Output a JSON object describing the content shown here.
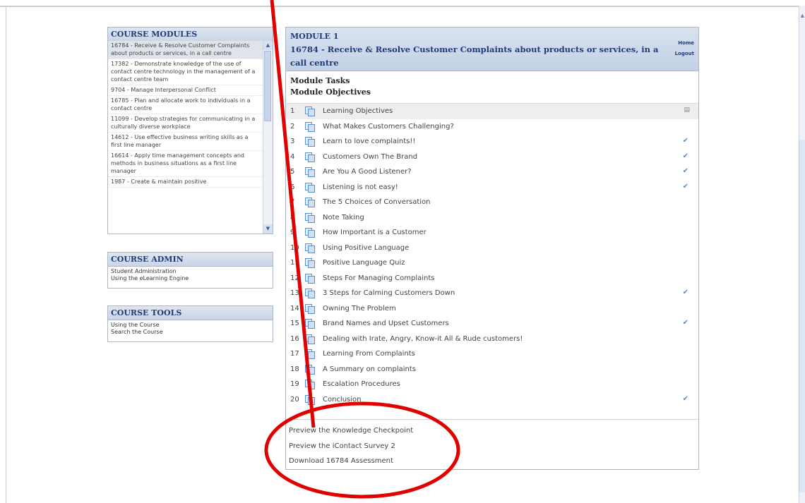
{
  "modules": {
    "title": "COURSE MODULES",
    "items": [
      "16784 - Receive & Resolve Customer Complaints about products or services, in a call centre",
      "17382 - Demonstrate knowledge of the use of contact centre technology in the management of a contact centre team",
      "9704 - Manage Interpersonal Conflict",
      "16785 - Plan and allocate work to individuals in a contact centre",
      "11099 - Develop strategies for communicating in a culturally diverse workplace",
      "14612 - Use effective business writing skills as a first line manager",
      "16614 - Apply time management concepts and methods in business situations as a first line manager",
      "1987 - Create & maintain positive"
    ]
  },
  "admin": {
    "title": "COURSE ADMIN",
    "links": [
      "Student Administration",
      "Using the eLearning Engine"
    ]
  },
  "tools": {
    "title": "COURSE TOOLS",
    "links": [
      "Using the Course",
      "Search the Course"
    ]
  },
  "main": {
    "module_label": "MODULE 1",
    "module_title": "16784 - Receive & Resolve Customer Complaints about products or services, in a call centre",
    "home": "Home",
    "logout": "Logout",
    "tasks": "Module Tasks",
    "objectives": "Module Objectives",
    "lessons": [
      {
        "num": "1",
        "label": "Learning Objectives",
        "check": false
      },
      {
        "num": "2",
        "label": "What Makes Customers Challenging?",
        "check": false
      },
      {
        "num": "3",
        "label": "Learn to love complaints!!",
        "check": true
      },
      {
        "num": "4",
        "label": "Customers Own The Brand",
        "check": true
      },
      {
        "num": "5",
        "label": "Are You A Good Listener?",
        "check": true
      },
      {
        "num": "6",
        "label": "Listening is not easy!",
        "check": true
      },
      {
        "num": "7",
        "label": "The 5 Choices of Conversation",
        "check": false
      },
      {
        "num": "8",
        "label": "Note Taking",
        "check": false
      },
      {
        "num": "9",
        "label": "How Important is a Customer",
        "check": false
      },
      {
        "num": "10",
        "label": "Using Positive Language",
        "check": false
      },
      {
        "num": "11",
        "label": "Positive Language Quiz",
        "check": false
      },
      {
        "num": "12",
        "label": "Steps For Managing Complaints",
        "check": false
      },
      {
        "num": "13",
        "label": "3 Steps for Calming Customers Down",
        "check": true
      },
      {
        "num": "14",
        "label": "Owning The Problem",
        "check": false
      },
      {
        "num": "15",
        "label": "Brand Names and Upset Customers",
        "check": true
      },
      {
        "num": "16",
        "label": "Dealing with Irate, Angry, Know-it All & Rude customers!",
        "check": false
      },
      {
        "num": "17",
        "label": "Learning From Complaints",
        "check": false
      },
      {
        "num": "18",
        "label": "A Summary on complaints",
        "check": false
      },
      {
        "num": "19",
        "label": "Escalation Procedures",
        "check": false
      },
      {
        "num": "20",
        "label": "Conclusion",
        "check": true
      }
    ],
    "bottom_links": [
      "Preview the Knowledge Checkpoint",
      "Preview the iContact Survey 2",
      "Download 16784 Assessment"
    ]
  },
  "icons": {
    "check": "check-icon",
    "lesson": "pages-icon"
  },
  "colors": {
    "annotation": "#e00000",
    "header_text": "#1f3a78",
    "check": "#5b87c9"
  }
}
